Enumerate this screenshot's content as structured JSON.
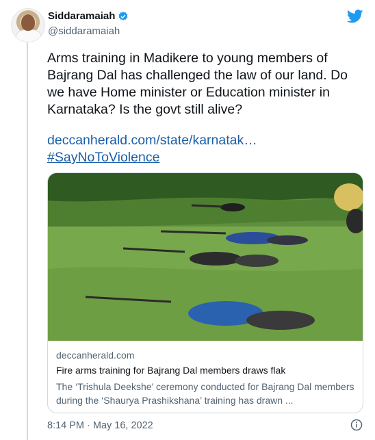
{
  "author": {
    "name": "Siddaramaiah",
    "handle": "@siddaramaiah"
  },
  "tweet": {
    "text": "Arms training in Madikere to young members of Bajrang Dal has challenged the law of our land. Do we have Home minister or Education minister in Karnataka? Is the govt still alive?",
    "link": "deccanherald.com/state/karnatak…",
    "hashtag": "#SayNoToViolence"
  },
  "card": {
    "domain": "deccanherald.com",
    "title": "Fire arms training for Bajrang Dal members draws flak",
    "description": "The ‘Trishula Deekshe’ ceremony conducted for Bajrang Dal members during the ‘Shaurya Prashikshana’ training has drawn ..."
  },
  "timestamp": "8:14 PM · May 16, 2022",
  "colors": {
    "link": "#1b5fa8",
    "twitter_blue": "#1d9bf0",
    "muted": "#536471",
    "border": "#cfd9de"
  },
  "icons": {
    "verified": "verified-badge-icon",
    "brand": "twitter-bird-icon",
    "info": "info-icon"
  }
}
